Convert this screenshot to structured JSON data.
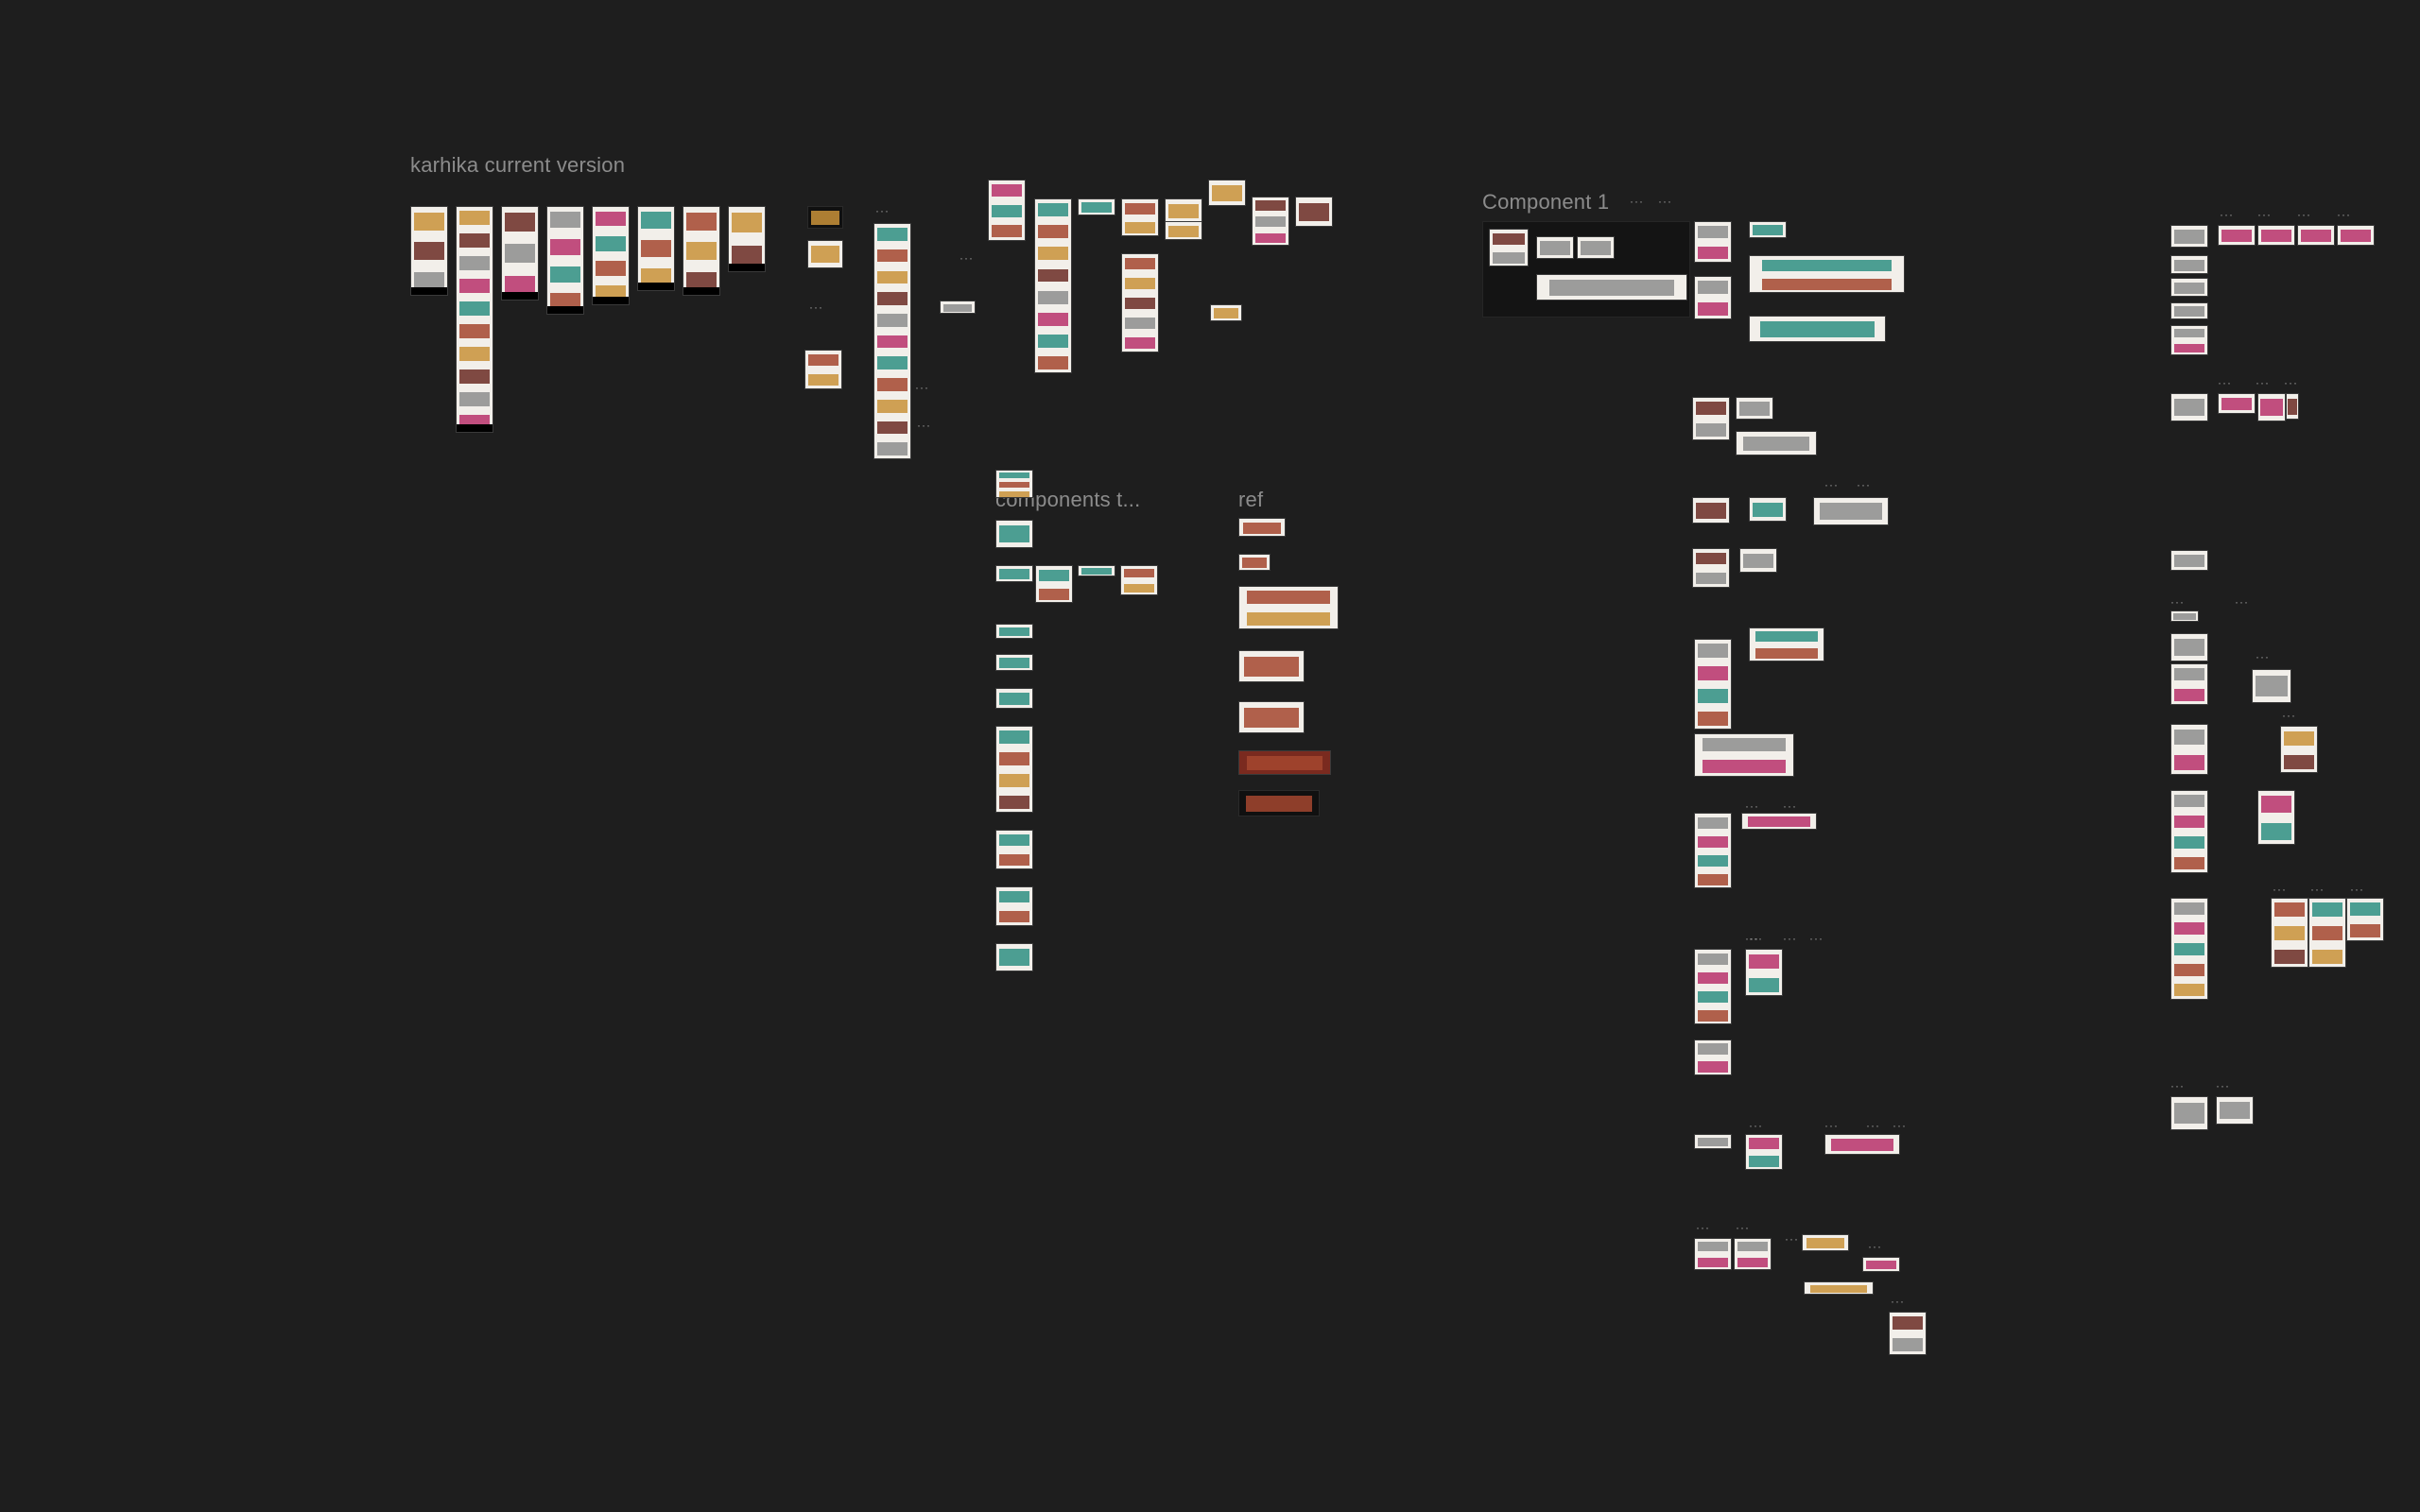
{
  "canvas": {
    "background": "#1e1e1e",
    "sections": [
      {
        "id": "karhika-current-version",
        "title": "karhika current version"
      },
      {
        "id": "component-1",
        "title": "Component 1"
      },
      {
        "id": "components-truncated",
        "title": "components t..."
      },
      {
        "id": "ref",
        "title": "ref"
      }
    ],
    "more_menu_glyph": "···"
  },
  "colors": {
    "frame_light": "#f2efea",
    "frame_dark": "#101010",
    "teal": "#2f8f83",
    "brick": "#a4462f",
    "ochre": "#c9923a",
    "maroon": "#6b2c25",
    "gray": "#8d8d8d",
    "magenta": "#b8316b"
  }
}
